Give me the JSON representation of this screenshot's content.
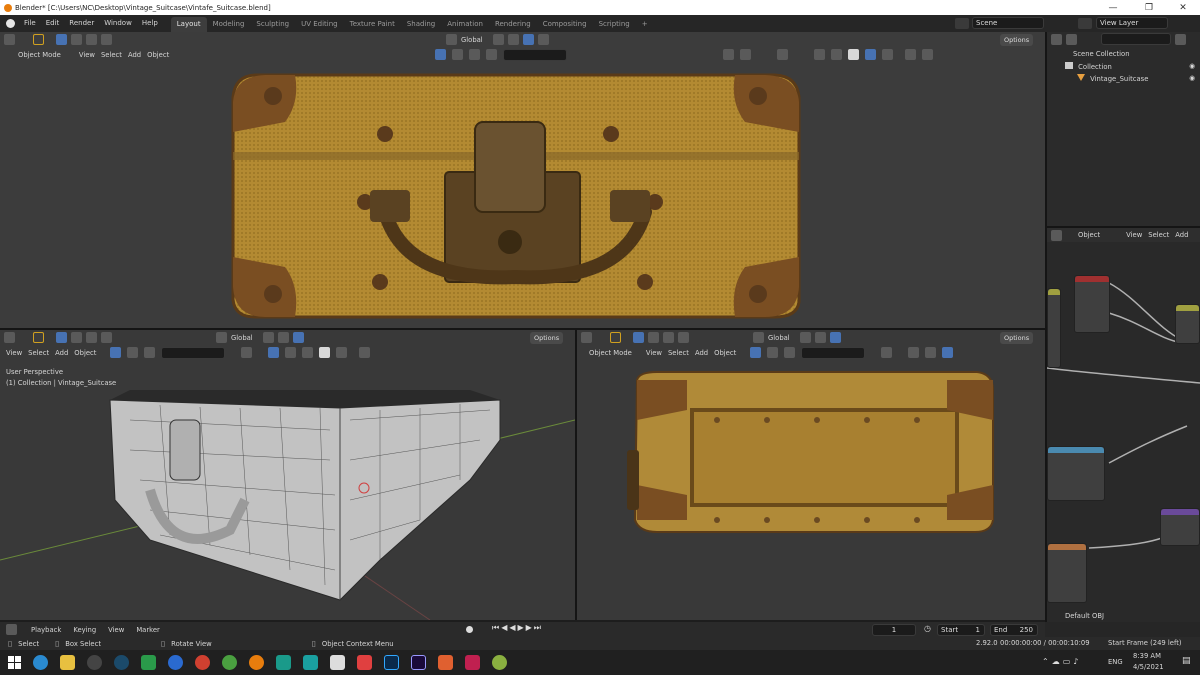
{
  "window": {
    "title": "Blender* [C:\\Users\\NC\\Desktop\\Vintage_Suitcase\\Vintafe_Suitcase.blend]",
    "minimize": "—",
    "maximize": "❐",
    "close": "✕"
  },
  "menus": [
    "File",
    "Edit",
    "Render",
    "Window",
    "Help"
  ],
  "workspace_tabs": [
    "Layout",
    "Modeling",
    "Sculpting",
    "UV Editing",
    "Texture Paint",
    "Shading",
    "Animation",
    "Rendering",
    "Compositing",
    "Scripting"
  ],
  "active_tab": "Layout",
  "add_tab": "+",
  "scene": {
    "label": "Scene",
    "view_layer": "View Layer"
  },
  "top_viewport": {
    "mode": "Object Mode",
    "menus": [
      "View",
      "Select",
      "Add",
      "Object"
    ],
    "transform": "Global",
    "options": "Options"
  },
  "left_viewport": {
    "menus": [
      "View",
      "Select",
      "Add",
      "Object"
    ],
    "transform": "Global",
    "options": "Options",
    "overlay_line1": "User Perspective",
    "overlay_line2": "(1) Collection | Vintage_Suitcase"
  },
  "right_viewport": {
    "mode": "Object Mode",
    "menus": [
      "View",
      "Select",
      "Add",
      "Object"
    ],
    "transform": "Global",
    "options": "Options"
  },
  "outliner": {
    "scene_collection": "Scene Collection",
    "collection": "Collection",
    "object": "Vintage_Suitcase"
  },
  "node_editor": {
    "menus": [
      "Object",
      "View",
      "Select",
      "Add"
    ],
    "footer_label": "Default OBJ"
  },
  "timeline": {
    "menus": [
      "Playback",
      "Keying",
      "View",
      "Marker"
    ],
    "frame": "1",
    "start_label": "Start",
    "start": "1",
    "end_label": "End",
    "end": "250"
  },
  "statusbar": {
    "select": "Select",
    "box_select": "Box Select",
    "rotate_view": "Rotate View",
    "context_menu": "Object Context Menu",
    "version": "2.92.0",
    "timecode": "00:00:00:00 / 00:00:10:09",
    "start_frame": "Start Frame (249 left)"
  },
  "taskbar": {
    "language": "ENG",
    "time": "8:39 AM",
    "date": "4/5/2021",
    "apps": [
      "file-explorer",
      "chrome-alt",
      "steam",
      "xbox",
      "zoom",
      "chrome",
      "app-green",
      "blender",
      "3d-app",
      "maya",
      "app-photo",
      "brave",
      "photoshop",
      "premiere",
      "app-orange",
      "app-red",
      "app-green2"
    ]
  },
  "colors": {
    "accent": "#4772b3",
    "suitcase_body": "#b08830",
    "suitcase_leather": "#6a4420",
    "viewport_bg": "#393939"
  }
}
